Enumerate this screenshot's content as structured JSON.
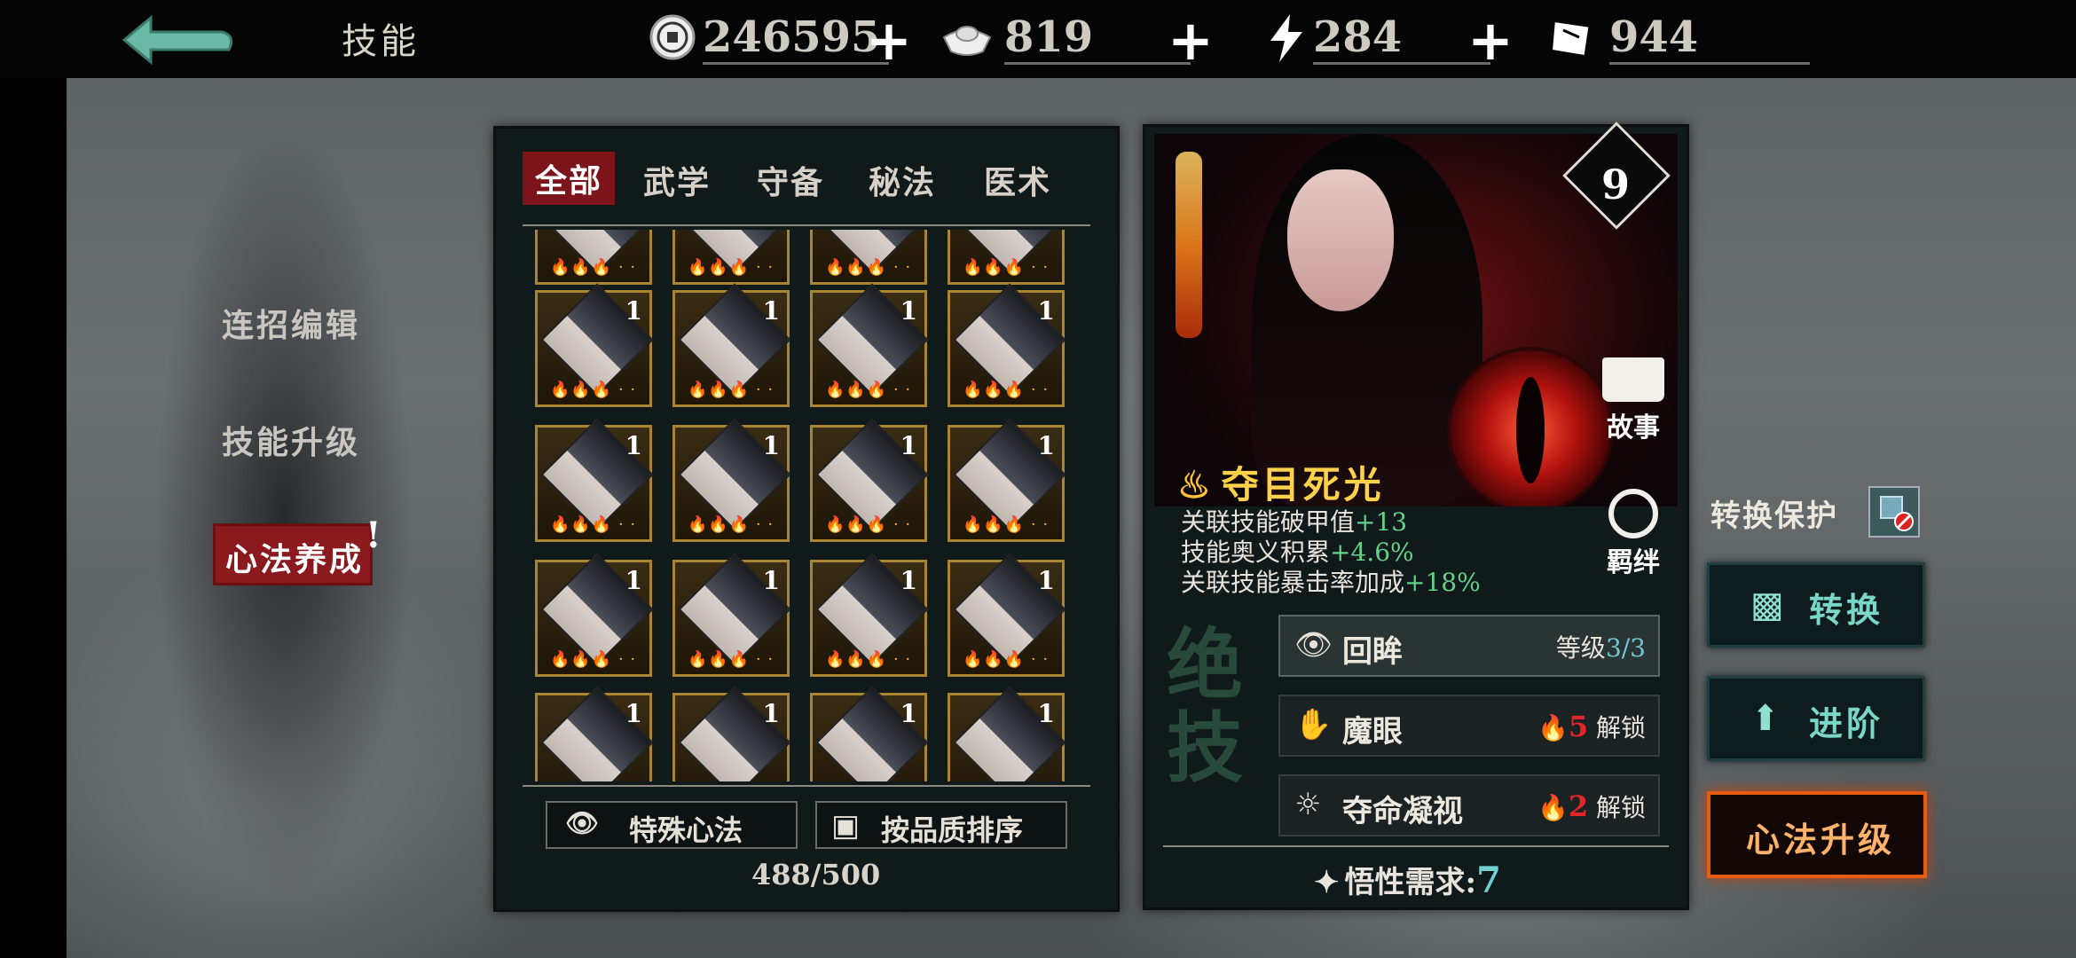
{
  "header": {
    "title": "技能",
    "currencies": [
      {
        "icon": "coin-icon",
        "value": "246595"
      },
      {
        "icon": "silver-ingot-icon",
        "value": "819"
      },
      {
        "icon": "lightning-icon",
        "value": "284"
      },
      {
        "icon": "ticket-icon",
        "value": "944"
      }
    ],
    "plus": "+"
  },
  "sidebar": {
    "items": [
      {
        "label": "连招编辑"
      },
      {
        "label": "技能升级"
      },
      {
        "label": "心法养成"
      }
    ],
    "alert": "!"
  },
  "tabs": [
    "全部",
    "武学",
    "守备",
    "秘法",
    "医术"
  ],
  "grid": {
    "card_badge": "1",
    "flames": "🔥🔥🔥 · ·"
  },
  "bottom": {
    "special_label": "特殊心法",
    "sort_label": "按品质排序",
    "count": "488/500"
  },
  "detail": {
    "level": "9",
    "story_label": "故事",
    "bond_label": "羁绊",
    "skill_name": "夺目死光",
    "stats": [
      {
        "label": "关联技能破甲值",
        "value": "+13"
      },
      {
        "label": "技能奥义积累",
        "value": "+4.6%"
      },
      {
        "label": "关联技能暴击率加成",
        "value": "+18%"
      }
    ],
    "vertical_title": "绝技",
    "skills": [
      {
        "name": "回眸",
        "level_label": "等级",
        "level": "3/3"
      },
      {
        "name": "魔眼",
        "cost": "5",
        "unlock": "解锁"
      },
      {
        "name": "夺命凝视",
        "cost": "2",
        "unlock": "解锁"
      }
    ],
    "wisdom_label": "悟性需求:",
    "wisdom_value": "7"
  },
  "right_actions": {
    "protect_label": "转换保护",
    "convert": "转换",
    "advance": "进阶",
    "upgrade": "心法升级"
  }
}
